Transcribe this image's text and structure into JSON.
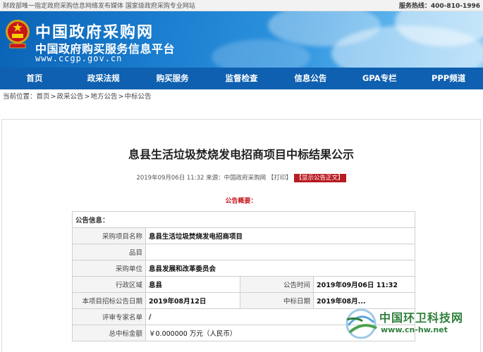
{
  "topbar": {
    "left": "财政部唯一指定政府采购信息网络发布媒体 国家级政府采购专业网站",
    "hotline": "服务热线：400-810-1996"
  },
  "banner": {
    "title": "中国政府采购网",
    "subtitle": "中国政府购买服务信息平台",
    "url": "www.ccgp.gov.cn"
  },
  "nav": [
    "首页",
    "政采法规",
    "购买服务",
    "监督检查",
    "信息公告",
    "GPA专栏",
    "PPP频道"
  ],
  "breadcrumb": {
    "prefix": "当前位置：",
    "items": [
      "首页",
      "政采公告",
      "地方公告",
      "中标公告"
    ]
  },
  "article": {
    "title": "息县生活垃圾焚烧发电招商项目中标结果公示",
    "meta_date": "2019年09月06日 11:32",
    "meta_source": "来源：中国政府采购网",
    "print_label": "【打印】",
    "show_label": "【显示公告正文】",
    "summary_label": "公告概要："
  },
  "info_table": {
    "header": "公告信息：",
    "rows": [
      {
        "label": "采购项目名称",
        "value": "息县生活垃圾焚烧发电招商项目"
      },
      {
        "label": "品目",
        "value": ""
      },
      {
        "label": "采购单位",
        "value": "息县发展和改革委员会"
      },
      {
        "label": "行政区域",
        "value": "息县",
        "label2": "公告时间",
        "value2": "2019年09月06日 11:32"
      },
      {
        "label": "本项目招标公告日期",
        "value": "2019年08月12日",
        "label2": "中标日期",
        "value2": "2019年08月..."
      },
      {
        "label": "评审专家名单",
        "value": "/"
      },
      {
        "label": "总中标金额",
        "value": "￥0.000000 万元（人民币）"
      }
    ]
  },
  "watermark": {
    "name": "中国环卫科技网",
    "url": "www.cn-hw.net"
  },
  "colors": {
    "nav_bg": "#0f60b0",
    "accent_red": "#c2121a",
    "watermark_green": "#2f7f3c"
  }
}
